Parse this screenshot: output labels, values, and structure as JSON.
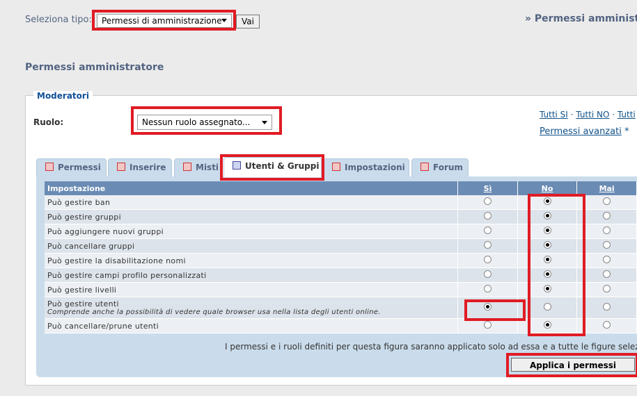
{
  "top": {
    "select_type_label": "Seleziona tipo:",
    "select_type_value": "Permessi di amministrazione",
    "go_button": "Vai",
    "header_right": "» Permessi amministra"
  },
  "page_title": "Permessi amministratore",
  "fieldset": {
    "legend": "Moderatori",
    "role_label": "Ruolo:",
    "role_value": "Nessun ruolo assegnato...",
    "all_yes": "Tutti SI",
    "all_no": "Tutti NO",
    "all_never": "Tutti",
    "sep": "·",
    "advanced": "Permessi avanzati",
    "advanced_mark": "*"
  },
  "tabs": [
    {
      "label": "Permessi"
    },
    {
      "label": "Inserire"
    },
    {
      "label": "Misti"
    },
    {
      "label": "Utenti & Gruppi",
      "active": true
    },
    {
      "label": "Impostazioni"
    },
    {
      "label": "Forum"
    }
  ],
  "table": {
    "headers": {
      "setting": "Impostazione",
      "yes": "Sì",
      "no": "No",
      "never": "Mai"
    },
    "rows": [
      {
        "label": "Può gestire ban",
        "value": "no"
      },
      {
        "label": "Può gestire gruppi",
        "value": "no"
      },
      {
        "label": "Può aggiungere nuovi gruppi",
        "value": "no"
      },
      {
        "label": "Può cancellare gruppi",
        "value": "no"
      },
      {
        "label": "Può gestire la disabilitazione nomi",
        "value": "no"
      },
      {
        "label": "Può gestire campi profilo personalizzati",
        "value": "no"
      },
      {
        "label": "Può gestire livelli",
        "value": "no"
      },
      {
        "label": "Può gestire utenti",
        "desc": "Comprende anche la possibilità di vedere quale browser usa nella lista degli utenti online.",
        "value": "yes"
      },
      {
        "label": "Può cancellare/prune utenti",
        "value": "no"
      }
    ]
  },
  "note": "I permessi e i ruoli definiti per questa figura saranno applicato solo ad essa e a tutte le figure seleziona",
  "apply_button": "Applica i permessi",
  "colors": {
    "highlight": "#e01b24",
    "table_header": "#6a8bb3",
    "tab_bg": "#cadceb"
  }
}
